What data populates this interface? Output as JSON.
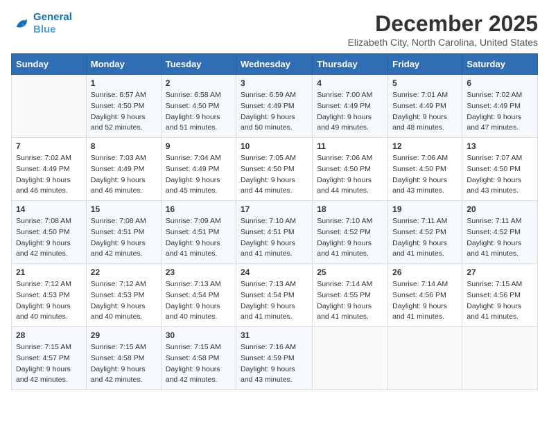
{
  "header": {
    "logo_line1": "General",
    "logo_line2": "Blue",
    "month_year": "December 2025",
    "location": "Elizabeth City, North Carolina, United States"
  },
  "weekdays": [
    "Sunday",
    "Monday",
    "Tuesday",
    "Wednesday",
    "Thursday",
    "Friday",
    "Saturday"
  ],
  "weeks": [
    [
      {
        "day": "",
        "sunrise": "",
        "sunset": "",
        "daylight": ""
      },
      {
        "day": "1",
        "sunrise": "6:57 AM",
        "sunset": "4:50 PM",
        "daylight": "9 hours and 52 minutes."
      },
      {
        "day": "2",
        "sunrise": "6:58 AM",
        "sunset": "4:50 PM",
        "daylight": "9 hours and 51 minutes."
      },
      {
        "day": "3",
        "sunrise": "6:59 AM",
        "sunset": "4:49 PM",
        "daylight": "9 hours and 50 minutes."
      },
      {
        "day": "4",
        "sunrise": "7:00 AM",
        "sunset": "4:49 PM",
        "daylight": "9 hours and 49 minutes."
      },
      {
        "day": "5",
        "sunrise": "7:01 AM",
        "sunset": "4:49 PM",
        "daylight": "9 hours and 48 minutes."
      },
      {
        "day": "6",
        "sunrise": "7:02 AM",
        "sunset": "4:49 PM",
        "daylight": "9 hours and 47 minutes."
      }
    ],
    [
      {
        "day": "7",
        "sunrise": "7:02 AM",
        "sunset": "4:49 PM",
        "daylight": "9 hours and 46 minutes."
      },
      {
        "day": "8",
        "sunrise": "7:03 AM",
        "sunset": "4:49 PM",
        "daylight": "9 hours and 46 minutes."
      },
      {
        "day": "9",
        "sunrise": "7:04 AM",
        "sunset": "4:49 PM",
        "daylight": "9 hours and 45 minutes."
      },
      {
        "day": "10",
        "sunrise": "7:05 AM",
        "sunset": "4:50 PM",
        "daylight": "9 hours and 44 minutes."
      },
      {
        "day": "11",
        "sunrise": "7:06 AM",
        "sunset": "4:50 PM",
        "daylight": "9 hours and 44 minutes."
      },
      {
        "day": "12",
        "sunrise": "7:06 AM",
        "sunset": "4:50 PM",
        "daylight": "9 hours and 43 minutes."
      },
      {
        "day": "13",
        "sunrise": "7:07 AM",
        "sunset": "4:50 PM",
        "daylight": "9 hours and 43 minutes."
      }
    ],
    [
      {
        "day": "14",
        "sunrise": "7:08 AM",
        "sunset": "4:50 PM",
        "daylight": "9 hours and 42 minutes."
      },
      {
        "day": "15",
        "sunrise": "7:08 AM",
        "sunset": "4:51 PM",
        "daylight": "9 hours and 42 minutes."
      },
      {
        "day": "16",
        "sunrise": "7:09 AM",
        "sunset": "4:51 PM",
        "daylight": "9 hours and 41 minutes."
      },
      {
        "day": "17",
        "sunrise": "7:10 AM",
        "sunset": "4:51 PM",
        "daylight": "9 hours and 41 minutes."
      },
      {
        "day": "18",
        "sunrise": "7:10 AM",
        "sunset": "4:52 PM",
        "daylight": "9 hours and 41 minutes."
      },
      {
        "day": "19",
        "sunrise": "7:11 AM",
        "sunset": "4:52 PM",
        "daylight": "9 hours and 41 minutes."
      },
      {
        "day": "20",
        "sunrise": "7:11 AM",
        "sunset": "4:52 PM",
        "daylight": "9 hours and 41 minutes."
      }
    ],
    [
      {
        "day": "21",
        "sunrise": "7:12 AM",
        "sunset": "4:53 PM",
        "daylight": "9 hours and 40 minutes."
      },
      {
        "day": "22",
        "sunrise": "7:12 AM",
        "sunset": "4:53 PM",
        "daylight": "9 hours and 40 minutes."
      },
      {
        "day": "23",
        "sunrise": "7:13 AM",
        "sunset": "4:54 PM",
        "daylight": "9 hours and 40 minutes."
      },
      {
        "day": "24",
        "sunrise": "7:13 AM",
        "sunset": "4:54 PM",
        "daylight": "9 hours and 41 minutes."
      },
      {
        "day": "25",
        "sunrise": "7:14 AM",
        "sunset": "4:55 PM",
        "daylight": "9 hours and 41 minutes."
      },
      {
        "day": "26",
        "sunrise": "7:14 AM",
        "sunset": "4:56 PM",
        "daylight": "9 hours and 41 minutes."
      },
      {
        "day": "27",
        "sunrise": "7:15 AM",
        "sunset": "4:56 PM",
        "daylight": "9 hours and 41 minutes."
      }
    ],
    [
      {
        "day": "28",
        "sunrise": "7:15 AM",
        "sunset": "4:57 PM",
        "daylight": "9 hours and 42 minutes."
      },
      {
        "day": "29",
        "sunrise": "7:15 AM",
        "sunset": "4:58 PM",
        "daylight": "9 hours and 42 minutes."
      },
      {
        "day": "30",
        "sunrise": "7:15 AM",
        "sunset": "4:58 PM",
        "daylight": "9 hours and 42 minutes."
      },
      {
        "day": "31",
        "sunrise": "7:16 AM",
        "sunset": "4:59 PM",
        "daylight": "9 hours and 43 minutes."
      },
      {
        "day": "",
        "sunrise": "",
        "sunset": "",
        "daylight": ""
      },
      {
        "day": "",
        "sunrise": "",
        "sunset": "",
        "daylight": ""
      },
      {
        "day": "",
        "sunrise": "",
        "sunset": "",
        "daylight": ""
      }
    ]
  ],
  "labels": {
    "sunrise_prefix": "Sunrise: ",
    "sunset_prefix": "Sunset: ",
    "daylight_prefix": "Daylight: "
  }
}
